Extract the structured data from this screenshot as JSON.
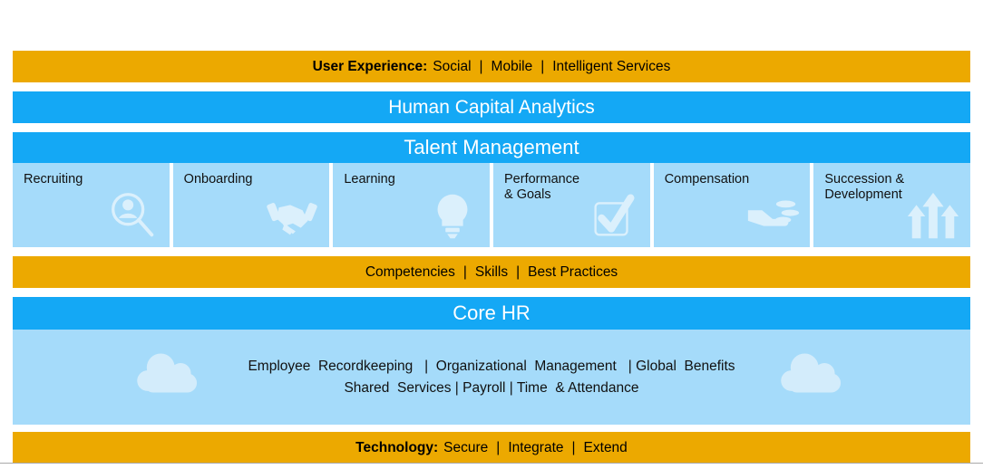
{
  "colors": {
    "gold": "#eca900",
    "blue": "#14a8f5",
    "light_blue": "#a5dbfa",
    "icon_fill": "#e3f3fd",
    "text_dark": "#111111",
    "text_light": "#ffffff"
  },
  "user_experience": {
    "lead": "User Experience:",
    "items": [
      "Social",
      "Mobile",
      "Intelligent Services"
    ],
    "separator": "|"
  },
  "analytics": {
    "title": "Human Capital Analytics"
  },
  "talent_management": {
    "title": "Talent Management",
    "cards": [
      {
        "label": "Recruiting",
        "icon": "person-search-icon"
      },
      {
        "label": "Onboarding",
        "icon": "handshake-icon"
      },
      {
        "label": "Learning",
        "icon": "lightbulb-icon"
      },
      {
        "label": "Performance\n& Goals",
        "icon": "checkbox-check-icon"
      },
      {
        "label": "Compensation",
        "icon": "hand-coins-icon"
      },
      {
        "label": "Succession &\nDevelopment",
        "icon": "up-arrows-icon"
      }
    ]
  },
  "competencies": {
    "items": [
      "Competencies",
      "Skills",
      "Best Practices"
    ],
    "separator": "|"
  },
  "core_hr": {
    "title": "Core HR",
    "line1": "Employee  Recordkeeping   |  Organizational  Management   | Global  Benefits",
    "line2": "Shared  Services | Payroll | Time  & Attendance",
    "cloud_icon": "cloud-icon"
  },
  "technology": {
    "lead": "Technology:",
    "items": [
      "Secure",
      "Integrate",
      "Extend"
    ],
    "separator": "|"
  }
}
